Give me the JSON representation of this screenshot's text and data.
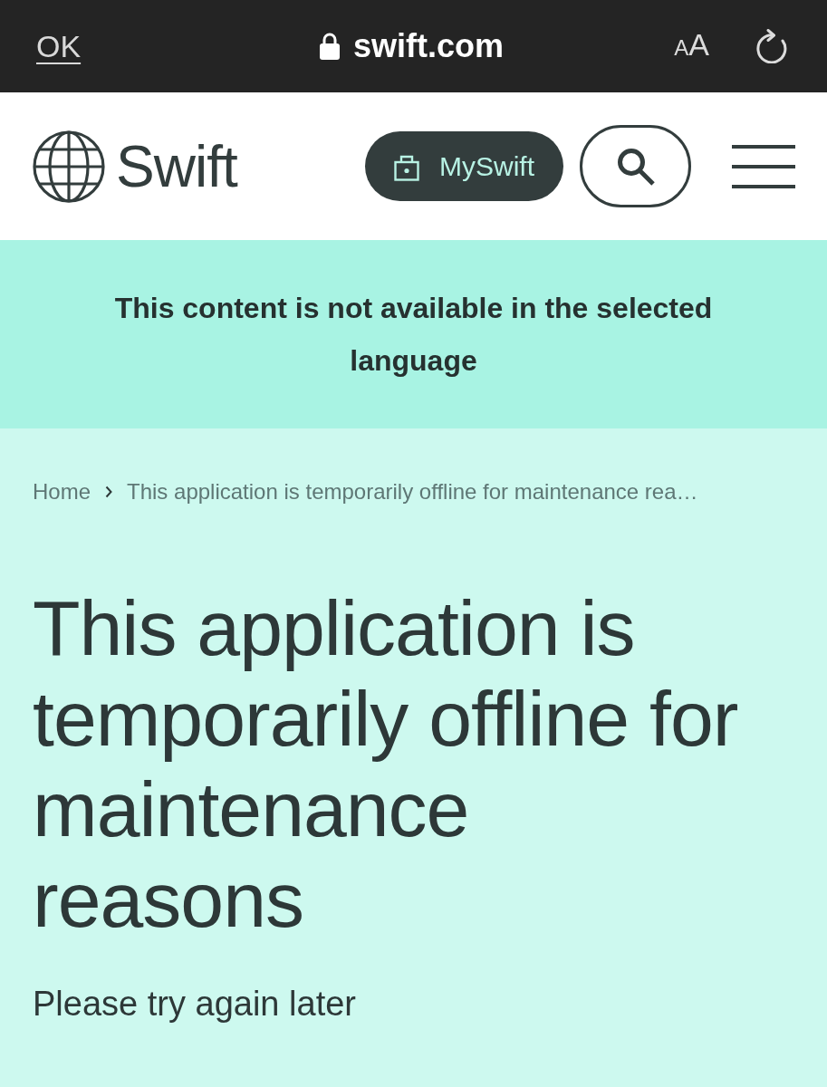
{
  "browser_bar": {
    "done_label": "OK",
    "secure": true,
    "url": "swift.com",
    "text_size_label": "AA"
  },
  "header": {
    "logo_text": "Swift",
    "account_button": "MySwift"
  },
  "notice": {
    "message": "This content is not available in the selected language"
  },
  "breadcrumb": [
    {
      "label": "Home"
    },
    {
      "label": "This application is temporarily offline for maintenance rea…"
    }
  ],
  "page": {
    "title": "This application is temporarily offline for maintenance reasons",
    "message": "Please try again later"
  }
}
